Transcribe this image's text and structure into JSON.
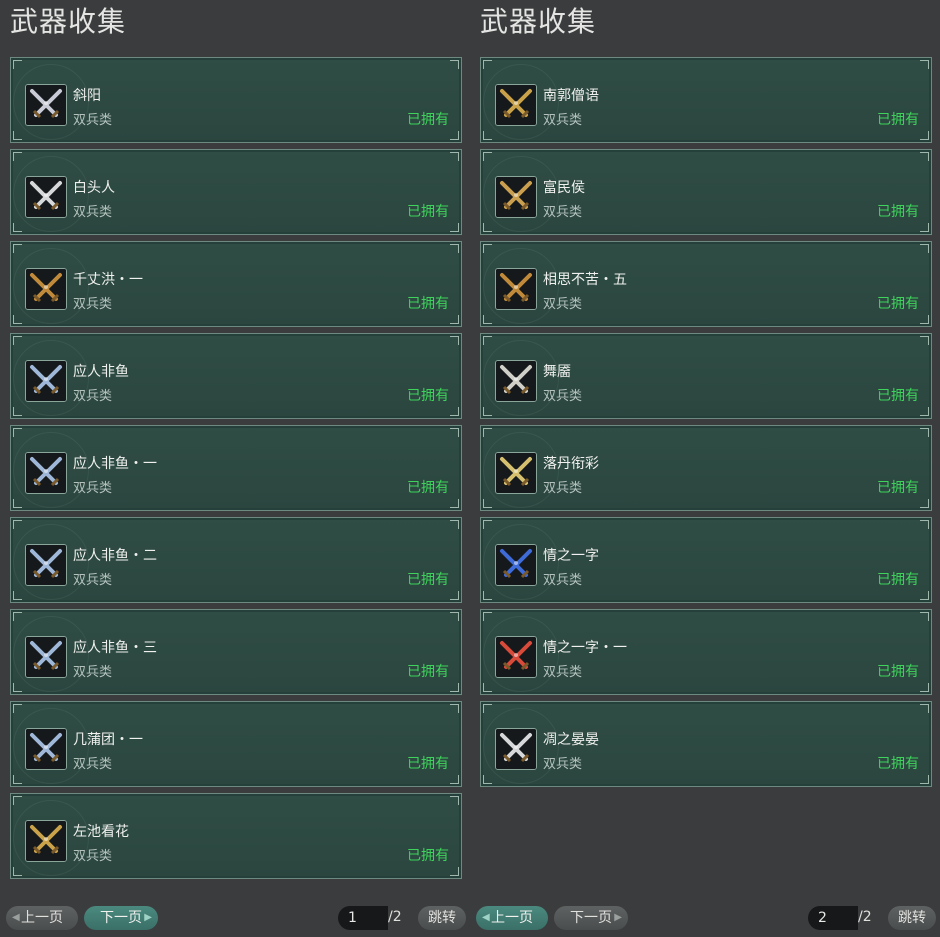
{
  "left_panel": {
    "title": "武器收集",
    "items": [
      {
        "name": "斜阳",
        "type": "双兵类",
        "status": "已拥有"
      },
      {
        "name": "白头人",
        "type": "双兵类",
        "status": "已拥有"
      },
      {
        "name": "千丈洪・一",
        "type": "双兵类",
        "status": "已拥有"
      },
      {
        "name": "应人非鱼",
        "type": "双兵类",
        "status": "已拥有"
      },
      {
        "name": "应人非鱼・一",
        "type": "双兵类",
        "status": "已拥有"
      },
      {
        "name": "应人非鱼・二",
        "type": "双兵类",
        "status": "已拥有"
      },
      {
        "name": "应人非鱼・三",
        "type": "双兵类",
        "status": "已拥有"
      },
      {
        "name": "几蒲团・一",
        "type": "双兵类",
        "status": "已拥有"
      },
      {
        "name": "左池看花",
        "type": "双兵类",
        "status": "已拥有"
      }
    ],
    "pagination": {
      "prev_label": "上一页",
      "next_label": "下一页",
      "page_value": "1",
      "total": "/2",
      "jump_label": "跳转"
    }
  },
  "right_panel": {
    "title": "武器收集",
    "items": [
      {
        "name": "南郭僧语",
        "type": "双兵类",
        "status": "已拥有"
      },
      {
        "name": "富民侯",
        "type": "双兵类",
        "status": "已拥有"
      },
      {
        "name": "相思不苦・五",
        "type": "双兵类",
        "status": "已拥有"
      },
      {
        "name": "舞靥",
        "type": "双兵类",
        "status": "已拥有"
      },
      {
        "name": "落丹衔彩",
        "type": "双兵类",
        "status": "已拥有"
      },
      {
        "name": "情之一字",
        "type": "双兵类",
        "status": "已拥有"
      },
      {
        "name": "情之一字・一",
        "type": "双兵类",
        "status": "已拥有"
      },
      {
        "name": "凋之晏晏",
        "type": "双兵类",
        "status": "已拥有"
      }
    ],
    "pagination": {
      "prev_label": "上一页",
      "next_label": "下一页",
      "page_value": "2",
      "total": "/2",
      "jump_label": "跳转"
    }
  },
  "colors": {
    "owned_status": "#3ed35a",
    "card_bg": "#2d4a43",
    "active_button": "#3f7a71"
  },
  "icons": [
    "crossed-swords-icon"
  ]
}
